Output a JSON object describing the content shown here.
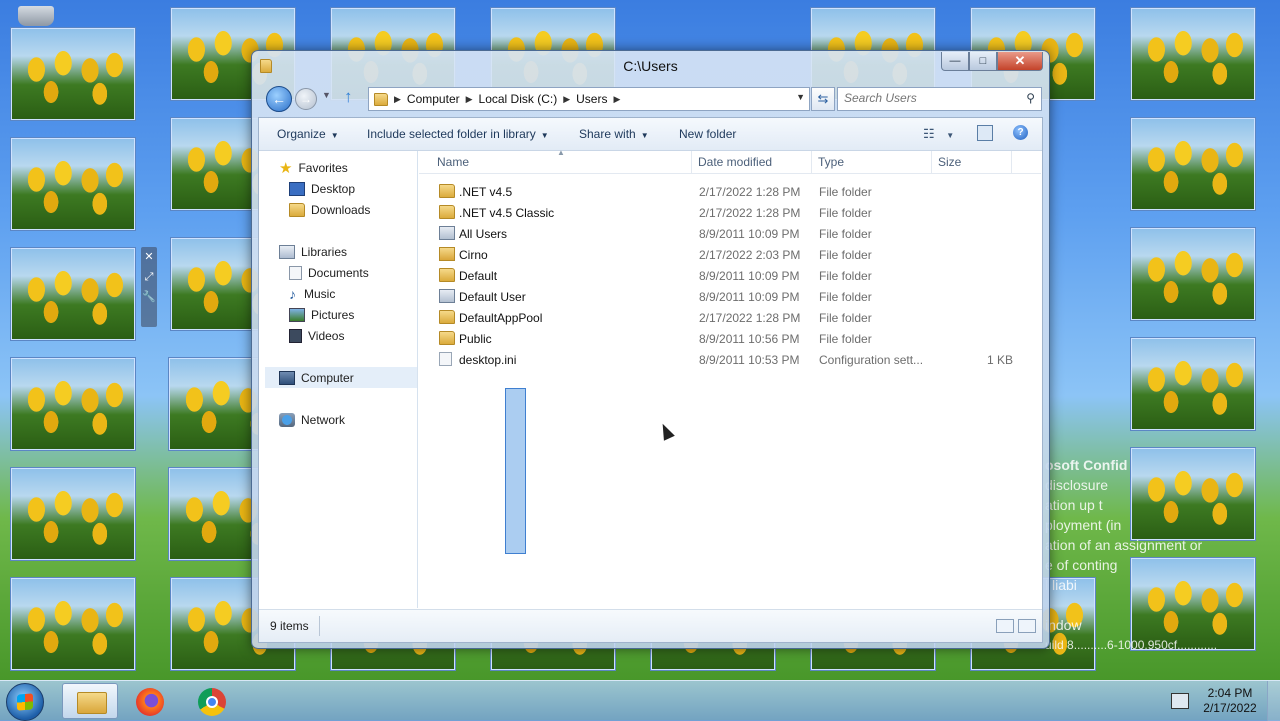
{
  "window": {
    "title": "C:\\Users",
    "minimize_label": "—",
    "maximize_label": "□",
    "close_label": "✕"
  },
  "address": {
    "crumbs": [
      "Computer",
      "Local Disk (C:)",
      "Users"
    ],
    "search_placeholder": "Search Users"
  },
  "toolbar": {
    "organize": "Organize",
    "include": "Include selected folder in library",
    "share": "Share with",
    "new_folder": "New folder"
  },
  "navpane": {
    "favorites": "Favorites",
    "desktop": "Desktop",
    "downloads": "Downloads",
    "libraries": "Libraries",
    "documents": "Documents",
    "music": "Music",
    "pictures": "Pictures",
    "videos": "Videos",
    "computer": "Computer",
    "network": "Network"
  },
  "columns": {
    "name": "Name",
    "date": "Date modified",
    "type": "Type",
    "size": "Size"
  },
  "files": [
    {
      "name": ".NET v4.5",
      "date": "2/17/2022 1:28 PM",
      "type": "File folder",
      "size": "",
      "icon": "folder-icon"
    },
    {
      "name": ".NET v4.5 Classic",
      "date": "2/17/2022 1:28 PM",
      "type": "File folder",
      "size": "",
      "icon": "folder-icon"
    },
    {
      "name": "All Users",
      "date": "8/9/2011 10:09 PM",
      "type": "File folder",
      "size": "",
      "icon": "folder-shortcut-icon"
    },
    {
      "name": "Cirno",
      "date": "2/17/2022 2:03 PM",
      "type": "File folder",
      "size": "",
      "icon": "user-folder-icon"
    },
    {
      "name": "Default",
      "date": "8/9/2011 10:09 PM",
      "type": "File folder",
      "size": "",
      "icon": "folder-icon"
    },
    {
      "name": "Default User",
      "date": "8/9/2011 10:09 PM",
      "type": "File folder",
      "size": "",
      "icon": "folder-shortcut-icon"
    },
    {
      "name": "DefaultAppPool",
      "date": "2/17/2022 1:28 PM",
      "type": "File folder",
      "size": "",
      "icon": "folder-icon"
    },
    {
      "name": "Public",
      "date": "8/9/2011 10:56 PM",
      "type": "File folder",
      "size": "",
      "icon": "folder-icon"
    },
    {
      "name": "desktop.ini",
      "date": "8/9/2011 10:53 PM",
      "type": "Configuration sett...",
      "size": "1 KB",
      "icon": "ini-file-icon"
    }
  ],
  "status": {
    "item_count": "9 items"
  },
  "taskbar": {
    "time": "2:04 PM",
    "date": "2/17/2022"
  },
  "wallpaper": {
    "line1": "osoft Confid",
    "line2": "disclosure",
    "line3": "ation up t",
    "line4": "ployment (in",
    "line5": "ation of an assignment or",
    "line6": "e of conting",
    "line7": "l liabi",
    "line8": "indow",
    "line9": "uild 8..........6-1000.950cf............"
  },
  "gadget": {
    "close": "✕",
    "size": "⤢",
    "options": "🔧"
  },
  "colors": {
    "accent": "#2a6fc9",
    "selection": "#66a4e6",
    "folder": "#dbab3c"
  }
}
